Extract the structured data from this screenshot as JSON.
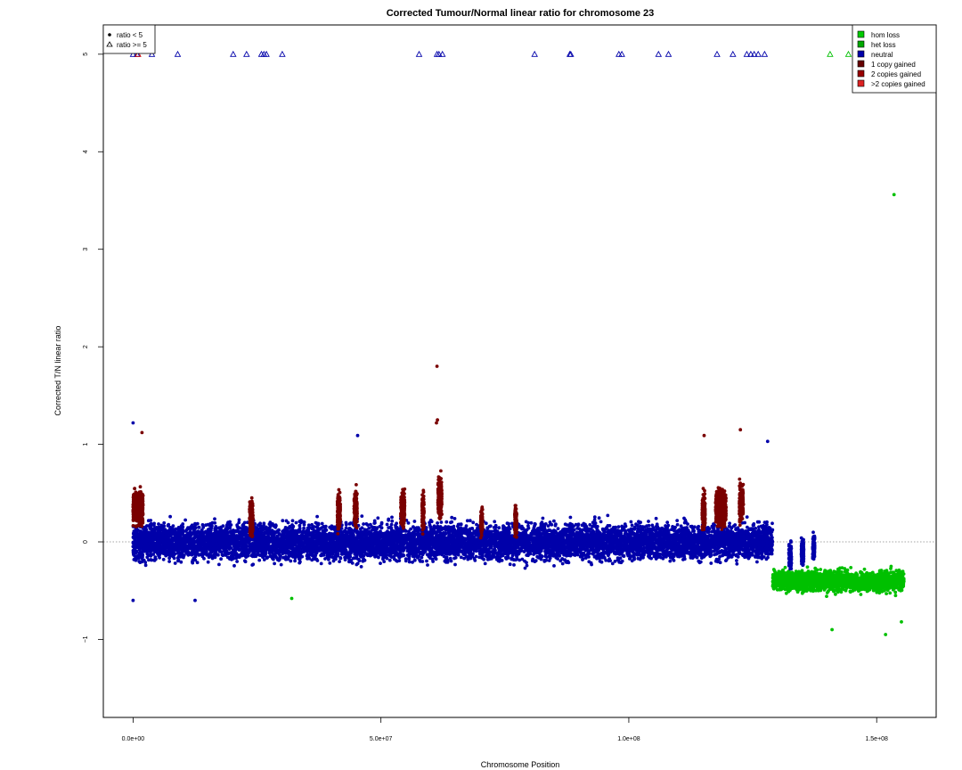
{
  "chart_data": {
    "type": "scatter",
    "title": "Corrected Tumour/Normal linear ratio for chromosome  23",
    "xlabel": "Chromosome Position",
    "ylabel": "Corrected T/N linear ratio",
    "xlim": [
      -6000000,
      162000000
    ],
    "ylim": [
      -1.8,
      5.3
    ],
    "x_ticks": [
      {
        "value": 0,
        "label": "0.0e+00"
      },
      {
        "value": 50000000,
        "label": "5.0e+07"
      },
      {
        "value": 100000000,
        "label": "1.0e+08"
      },
      {
        "value": 150000000,
        "label": "1.5e+08"
      }
    ],
    "y_ticks": [
      {
        "value": -1,
        "label": "−1"
      },
      {
        "value": 0,
        "label": "0"
      },
      {
        "value": 1,
        "label": "1"
      },
      {
        "value": 2,
        "label": "2"
      },
      {
        "value": 3,
        "label": "3"
      },
      {
        "value": 4,
        "label": "4"
      },
      {
        "value": 5,
        "label": "5"
      }
    ],
    "reference_line": {
      "y": 0,
      "style": "dotted"
    },
    "point_legend": [
      {
        "label": "ratio < 5",
        "marker": "dot"
      },
      {
        "label": "ratio >= 5",
        "marker": "triangle"
      }
    ],
    "state_legend": [
      {
        "label": "hom loss",
        "color": "#00cc00"
      },
      {
        "label": "het loss",
        "color": "#00aa00"
      },
      {
        "label": "neutral",
        "color": "#0000aa"
      },
      {
        "label": "1 copy gained",
        "color": "#660000"
      },
      {
        "label": "2 copies gained",
        "color": "#990000"
      },
      {
        "label": ">2 copies gained",
        "color": "#dd2222"
      }
    ],
    "colors": {
      "neutral": "#0000aa",
      "gained": "#7a0000",
      "loss": "#00c000",
      "triangle_red": "#cc0000"
    },
    "regions": [
      {
        "state": "neutral",
        "x_start": 0,
        "x_end": 129000000,
        "y_center": 0.0,
        "spread": 0.32
      },
      {
        "state": "loss",
        "x_start": 129000000,
        "x_end": 155500000,
        "y_center": -0.4,
        "spread": 0.18
      }
    ],
    "gain_segments": [
      {
        "x_start": 0,
        "x_end": 2000000,
        "y_center": 0.35,
        "spread": 0.28
      },
      {
        "x_start": 23500000,
        "x_end": 24200000,
        "y_center": 0.25,
        "spread": 0.3
      },
      {
        "x_start": 41200000,
        "x_end": 41800000,
        "y_center": 0.3,
        "spread": 0.3
      },
      {
        "x_start": 44600000,
        "x_end": 45200000,
        "y_center": 0.35,
        "spread": 0.3
      },
      {
        "x_start": 54000000,
        "x_end": 54800000,
        "y_center": 0.35,
        "spread": 0.3
      },
      {
        "x_start": 58300000,
        "x_end": 58700000,
        "y_center": 0.3,
        "spread": 0.3
      },
      {
        "x_start": 61500000,
        "x_end": 62300000,
        "y_center": 0.45,
        "spread": 0.35
      },
      {
        "x_start": 70100000,
        "x_end": 70500000,
        "y_center": 0.2,
        "spread": 0.25
      },
      {
        "x_start": 77000000,
        "x_end": 77400000,
        "y_center": 0.2,
        "spread": 0.25
      },
      {
        "x_start": 114800000,
        "x_end": 115400000,
        "y_center": 0.3,
        "spread": 0.3
      },
      {
        "x_start": 117500000,
        "x_end": 119600000,
        "y_center": 0.35,
        "spread": 0.3
      },
      {
        "x_start": 122300000,
        "x_end": 123100000,
        "y_center": 0.4,
        "spread": 0.3
      }
    ],
    "neutral_in_loss_segments": [
      {
        "x_start": 132300000,
        "x_end": 132800000,
        "y_center": -0.15,
        "spread": 0.2
      },
      {
        "x_start": 134800000,
        "x_end": 135300000,
        "y_center": -0.1,
        "spread": 0.2
      },
      {
        "x_start": 137100000,
        "x_end": 137500000,
        "y_center": -0.05,
        "spread": 0.2
      }
    ],
    "outliers": [
      {
        "x": 61300000,
        "y": 1.8,
        "state": "gained"
      },
      {
        "x": 61400000,
        "y": 1.25,
        "state": "gained"
      },
      {
        "x": 61200000,
        "y": 1.22,
        "state": "gained"
      },
      {
        "x": 0,
        "y": 1.22,
        "state": "neutral"
      },
      {
        "x": 1800000,
        "y": 1.12,
        "state": "gained"
      },
      {
        "x": 122500000,
        "y": 1.15,
        "state": "gained"
      },
      {
        "x": 115200000,
        "y": 1.09,
        "state": "gained"
      },
      {
        "x": 45300000,
        "y": 1.09,
        "state": "neutral"
      },
      {
        "x": 128000000,
        "y": 1.03,
        "state": "neutral"
      },
      {
        "x": 153500000,
        "y": 3.56,
        "state": "loss"
      },
      {
        "x": 0,
        "y": -0.6,
        "state": "neutral"
      },
      {
        "x": 12500000,
        "y": -0.6,
        "state": "neutral"
      },
      {
        "x": 32000000,
        "y": -0.58,
        "state": "loss"
      },
      {
        "x": 141000000,
        "y": -0.9,
        "state": "loss"
      },
      {
        "x": 151800000,
        "y": -0.95,
        "state": "loss"
      },
      {
        "x": 155000000,
        "y": -0.82,
        "state": "loss"
      }
    ],
    "triangles": [
      {
        "x": 0,
        "state": "neutral"
      },
      {
        "x": 800000,
        "state": "neutral"
      },
      {
        "x": 1000000,
        "state": "triangle_red"
      },
      {
        "x": 3800000,
        "state": "neutral"
      },
      {
        "x": 9000000,
        "state": "neutral"
      },
      {
        "x": 20200000,
        "state": "neutral"
      },
      {
        "x": 22900000,
        "state": "neutral"
      },
      {
        "x": 25900000,
        "state": "neutral"
      },
      {
        "x": 26400000,
        "state": "neutral"
      },
      {
        "x": 26900000,
        "state": "neutral"
      },
      {
        "x": 30100000,
        "state": "neutral"
      },
      {
        "x": 57700000,
        "state": "neutral"
      },
      {
        "x": 61300000,
        "state": "neutral"
      },
      {
        "x": 61700000,
        "state": "neutral"
      },
      {
        "x": 62400000,
        "state": "neutral"
      },
      {
        "x": 81000000,
        "state": "neutral"
      },
      {
        "x": 88100000,
        "state": "neutral"
      },
      {
        "x": 88300000,
        "state": "neutral"
      },
      {
        "x": 98000000,
        "state": "neutral"
      },
      {
        "x": 98600000,
        "state": "neutral"
      },
      {
        "x": 106000000,
        "state": "neutral"
      },
      {
        "x": 108000000,
        "state": "neutral"
      },
      {
        "x": 117800000,
        "state": "neutral"
      },
      {
        "x": 121000000,
        "state": "neutral"
      },
      {
        "x": 123800000,
        "state": "neutral"
      },
      {
        "x": 124600000,
        "state": "neutral"
      },
      {
        "x": 125300000,
        "state": "neutral"
      },
      {
        "x": 126100000,
        "state": "neutral"
      },
      {
        "x": 127400000,
        "state": "neutral"
      },
      {
        "x": 140600000,
        "state": "loss"
      },
      {
        "x": 144300000,
        "state": "loss"
      },
      {
        "x": 147600000,
        "state": "loss"
      },
      {
        "x": 149600000,
        "state": "loss"
      },
      {
        "x": 150900000,
        "state": "loss"
      }
    ]
  }
}
